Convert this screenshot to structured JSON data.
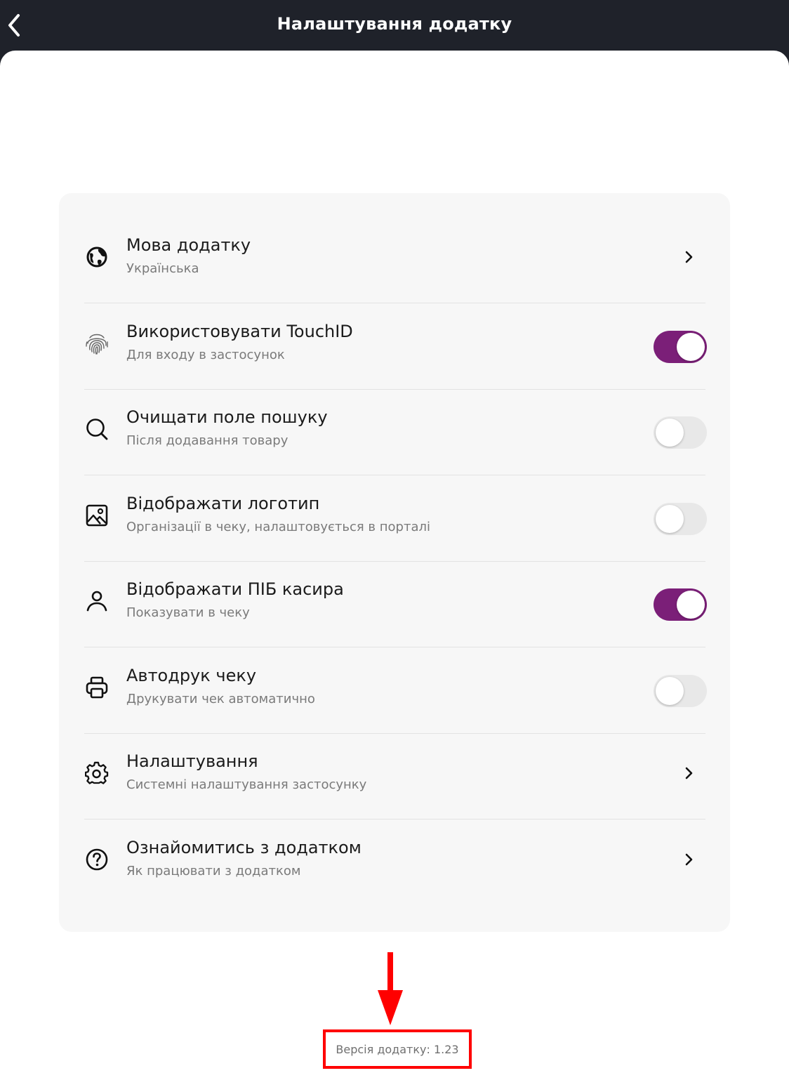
{
  "header": {
    "title": "Налаштування додатку"
  },
  "settings": [
    {
      "icon": "globe-icon",
      "title": "Мова додатку",
      "subtitle": "Українська",
      "control": "chevron"
    },
    {
      "icon": "fingerprint-icon",
      "title": "Використовувати TouchID",
      "subtitle": "Для входу в застосунок",
      "control": "toggle",
      "on": true
    },
    {
      "icon": "search-icon",
      "title": "Очищати поле пошуку",
      "subtitle": "Після додавання товару",
      "control": "toggle",
      "on": false
    },
    {
      "icon": "image-icon",
      "title": "Відображати логотип",
      "subtitle": "Організації в чеку, налаштовується в порталі",
      "control": "toggle",
      "on": false
    },
    {
      "icon": "user-icon",
      "title": "Відображати ПІБ касира",
      "subtitle": "Показувати в чеку",
      "control": "toggle",
      "on": true
    },
    {
      "icon": "printer-icon",
      "title": "Автодрук чеку",
      "subtitle": "Друкувати чек автоматично",
      "control": "toggle",
      "on": false
    },
    {
      "icon": "gear-icon",
      "title": "Налаштування",
      "subtitle": "Системні налаштування застосунку",
      "control": "chevron"
    },
    {
      "icon": "help-circle-icon",
      "title": "Ознайомитись з додатком",
      "subtitle": "Як працювати з додатком",
      "control": "chevron"
    }
  ],
  "footer": {
    "version": "Версія додатку: 1.23"
  },
  "colors": {
    "header_bg": "#1f222a",
    "toggle_on": "#7b1f78",
    "toggle_off": "#e8e8e8",
    "highlight": "#ff0000"
  }
}
